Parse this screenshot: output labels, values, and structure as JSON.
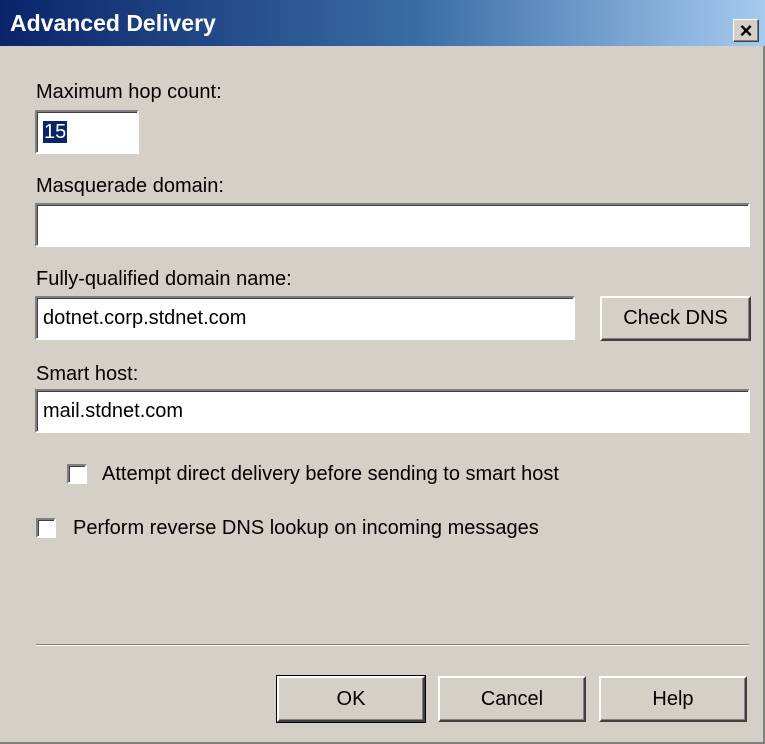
{
  "window": {
    "title": "Advanced Delivery",
    "close_label": "×"
  },
  "fields": {
    "max_hop_count": {
      "label": "Maximum hop count:",
      "value": "15"
    },
    "masquerade_domain": {
      "label": "Masquerade domain:",
      "value": ""
    },
    "fqdn": {
      "label": "Fully-qualified domain name:",
      "value": "dotnet.corp.stdnet.com"
    },
    "smart_host": {
      "label": "Smart host:",
      "value": "mail.stdnet.com"
    }
  },
  "buttons": {
    "check_dns": "Check DNS",
    "ok": "OK",
    "cancel": "Cancel",
    "help": "Help"
  },
  "checkboxes": {
    "direct_delivery": {
      "label": "Attempt direct delivery before sending to smart host",
      "checked": false
    },
    "reverse_dns": {
      "label": "Perform reverse DNS lookup on incoming messages",
      "checked": false
    }
  },
  "colors": {
    "title_bar_start": "#0a246a",
    "title_bar_end": "#a6caf0",
    "dialog_face": "#d4d0c8",
    "selection": "#0a246a"
  }
}
